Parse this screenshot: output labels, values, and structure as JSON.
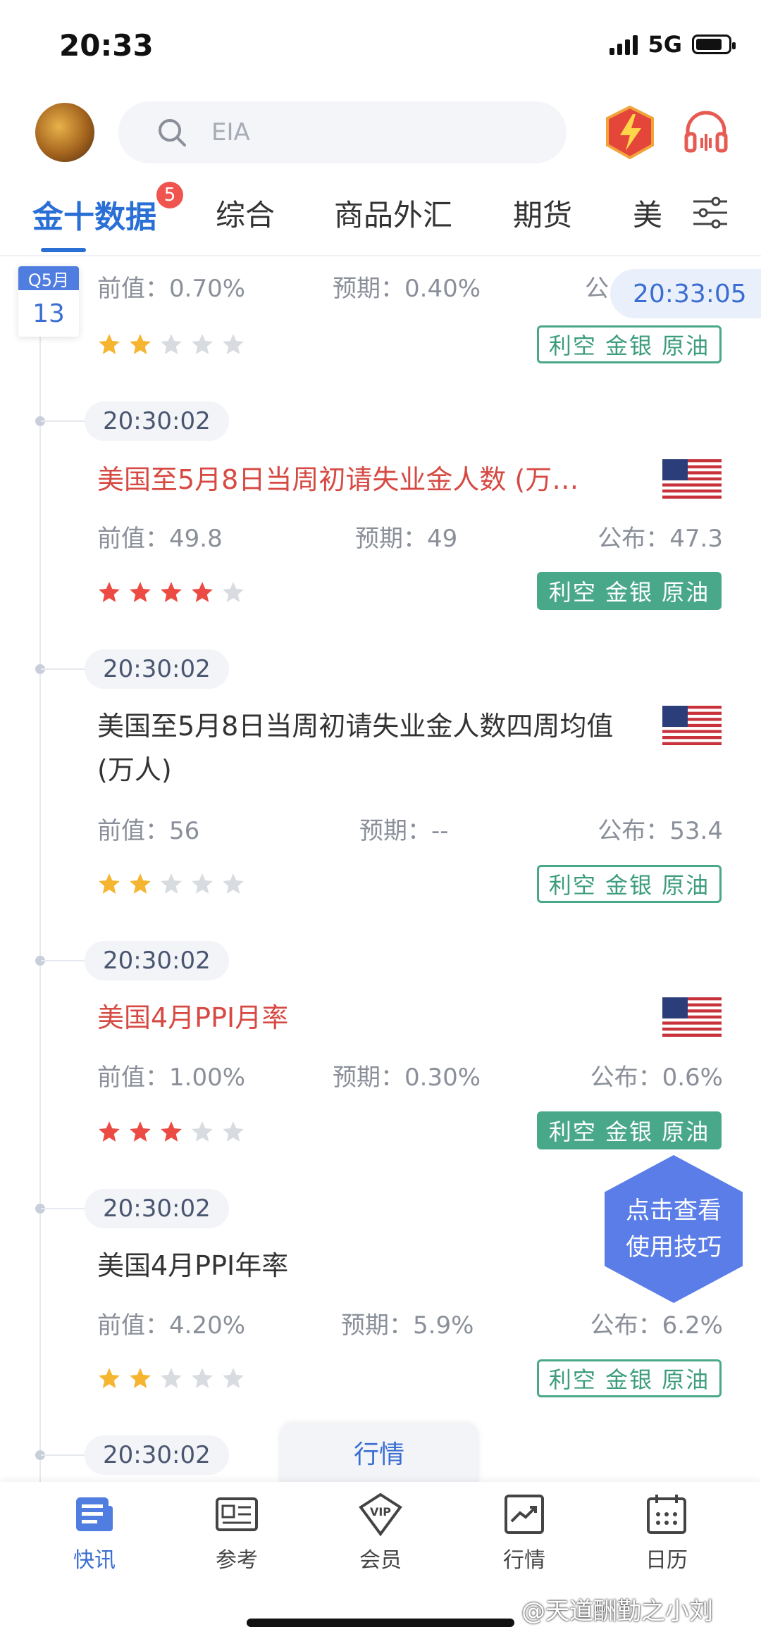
{
  "status_bar": {
    "time": "20:33",
    "network": "5G"
  },
  "search": {
    "placeholder": "EIA"
  },
  "tabs": [
    {
      "label": "金十数据",
      "badge": "5"
    },
    {
      "label": "综合"
    },
    {
      "label": "商品外汇"
    },
    {
      "label": "期货"
    },
    {
      "label": "美"
    }
  ],
  "date_badge": {
    "month": "Q5月",
    "day": "13"
  },
  "clock": "20:33:05",
  "top_partial": {
    "prev": "前值：0.70%",
    "expect": "预期：0.40%",
    "actual": "公",
    "stars": 2,
    "star_color": "#f5b531",
    "tag": "利空 金银 原油"
  },
  "events": [
    {
      "time": "20:30:02",
      "title": "美国至5月8日当周初请失业金人数 (万…",
      "highlight": true,
      "prev": "前值：49.8",
      "expect": "预期：49",
      "actual": "公布：47.3",
      "stars": 4,
      "star_color": "#ec4b44",
      "tag": "利空 金银 原油",
      "tag_filled": true
    },
    {
      "time": "20:30:02",
      "title": "美国至5月8日当周初请失业金人数四周均值 (万人)",
      "highlight": false,
      "prev": "前值：56",
      "expect": "预期：--",
      "actual": "公布：53.4",
      "stars": 2,
      "star_color": "#f5b531",
      "tag": "利空 金银 原油",
      "tag_filled": false
    },
    {
      "time": "20:30:02",
      "title": "美国4月PPI月率",
      "highlight": true,
      "prev": "前值：1.00%",
      "expect": "预期：0.30%",
      "actual": "公布：0.6%",
      "stars": 3,
      "star_color": "#ec4b44",
      "tag": "利空 金银 原油",
      "tag_filled": true
    },
    {
      "time": "20:30:02",
      "title": "美国4月PPI年率",
      "highlight": false,
      "prev": "前值：4.20%",
      "expect": "预期：5.9%",
      "actual": "公布：6.2%",
      "stars": 2,
      "star_color": "#f5b531",
      "tag": "利空 金银 原油",
      "tag_filled": false
    },
    {
      "time": "20:30:02"
    }
  ],
  "help_button": {
    "line1": "点击查看",
    "line2": "使用技巧"
  },
  "market_pill": "行情",
  "bottom_nav": [
    {
      "label": "快讯",
      "icon": "news-icon",
      "active": true
    },
    {
      "label": "参考",
      "icon": "id-card-icon",
      "active": false
    },
    {
      "label": "会员",
      "icon": "vip-icon",
      "active": false
    },
    {
      "label": "行情",
      "icon": "chart-icon",
      "active": false
    },
    {
      "label": "日历",
      "icon": "calendar-icon",
      "active": false
    }
  ],
  "watermark": "@天道酬勤之小刘"
}
